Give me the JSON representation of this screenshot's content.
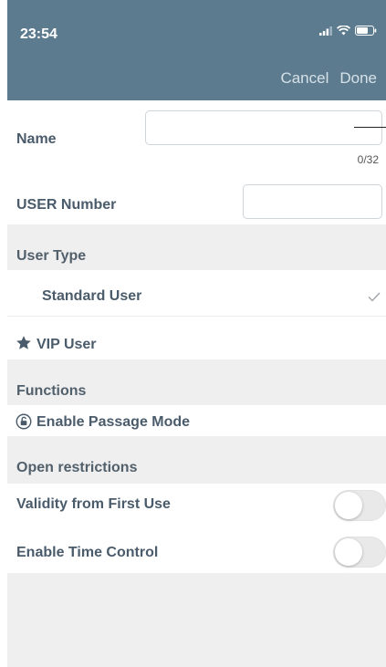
{
  "status_bar": {
    "time": "23:54"
  },
  "nav": {
    "cancel_label": "Cancel",
    "done_label": "Done"
  },
  "name_field": {
    "label": "Name",
    "value": "",
    "placeholder": "",
    "counter": "0/32"
  },
  "user_number_field": {
    "label": "USER Number",
    "value": "",
    "placeholder": ""
  },
  "user_type": {
    "section_title": "User Type",
    "options": [
      {
        "label": "Standard User",
        "selected": true
      },
      {
        "label": "VIP User",
        "selected": false
      }
    ]
  },
  "functions": {
    "section_title": "Functions",
    "passage_mode_label": "Enable Passage Mode"
  },
  "open_restrictions": {
    "section_title": "Open restrictions",
    "validity_label": "Validity from First Use",
    "validity_on": false,
    "time_control_label": "Enable Time Control",
    "time_control_on": false
  },
  "colors": {
    "header": "#5d7b8f",
    "label": "#4a5b6b",
    "section_bg": "#efefef",
    "check": "#9aa0a6"
  }
}
